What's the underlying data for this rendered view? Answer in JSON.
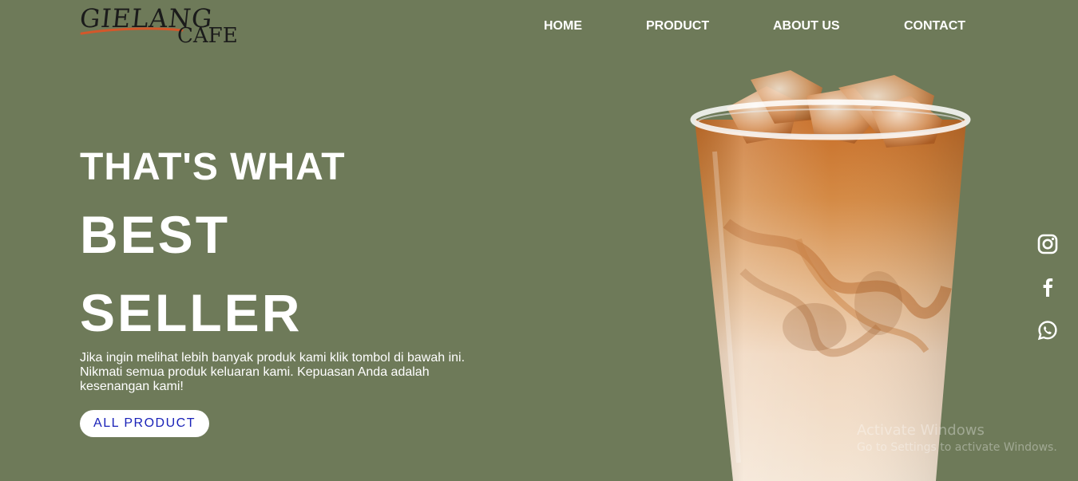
{
  "logo": {
    "word1": "GIELANG",
    "word2": "CAFE",
    "accent_color": "#d4572a"
  },
  "nav": {
    "items": [
      {
        "label": "HOME"
      },
      {
        "label": "PRODUCT"
      },
      {
        "label": "ABOUT US"
      },
      {
        "label": "CONTACT"
      }
    ]
  },
  "hero": {
    "line1": "THAT'S WHAT",
    "line2": "BEST",
    "line3": "SELLER",
    "description": "Jika ingin melihat lebih banyak produk kami klik tombol di bawah ini. Nikmati semua produk keluaran kami. Kepuasan Anda adalah kesenangan kami!",
    "button_label": "ALL PRODUCT"
  },
  "social": {
    "icons": [
      "instagram-icon",
      "facebook-icon",
      "whatsapp-icon"
    ]
  },
  "watermark": {
    "line1": "Activate Windows",
    "line2": "Go to Settings to activate Windows."
  },
  "colors": {
    "background": "#6e7a59",
    "button_text": "#1a22b8"
  }
}
